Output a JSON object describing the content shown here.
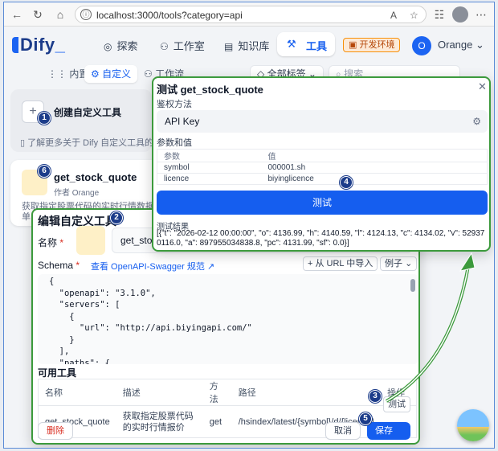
{
  "browser": {
    "url": "localhost:3000/tools?category=api",
    "info_icon": "ⓘ",
    "icons": [
      "back-icon",
      "refresh-icon",
      "home-icon",
      "read-aloud-icon",
      "favorite-icon",
      "collections-icon",
      "profile-icon",
      "more-icon"
    ]
  },
  "header": {
    "logo": "Dify",
    "nav": {
      "explore": "探索",
      "studio": "工作室",
      "knowledge": "知识库",
      "tools": "工具"
    },
    "env_badge": "开发环境",
    "user": {
      "initial": "O",
      "name": "Orange"
    }
  },
  "tabs": {
    "builtin": "内置",
    "custom": "自定义",
    "workflow": "工作流"
  },
  "filters": {
    "tags": "全部标签",
    "search_placeholder": "搜索"
  },
  "create_card": {
    "title": "创建自定义工具",
    "link": "了解更多关于 Dify 自定义工具的信"
  },
  "tool_card": {
    "name": "get_stock_quote",
    "author": "作者 Orange",
    "desc": "获取指定股票代码的实时行情数据，单日有限…跌"
  },
  "edit_dialog": {
    "title": "编辑自定义工具",
    "name_label": "名称",
    "name_value": "get_stock_quote",
    "schema_label": "Schema",
    "swagger_link": "查看 OpenAPI-Swagger 规范",
    "import_url": "+ 从 URL 中导入",
    "examples": "例子",
    "code": "{\n  \"openapi\": \"3.1.0\",\n  \"servers\": [\n    {\n      \"url\": \"http://api.biyingapi.com/\"\n    }\n  ],\n  \"paths\": {\n    \"/hsindex/latest/{",
    "tools_label": "可用工具",
    "columns": [
      "名称",
      "描述",
      "方法",
      "路径",
      "操作"
    ],
    "rows": [
      [
        "get_stock_quote",
        "获取指定股票代码的实时行情报价",
        "get",
        "/hsindex/latest/{symbol}/d/{licence}",
        "测试"
      ]
    ],
    "delete": "删除",
    "cancel": "取消",
    "save": "保存"
  },
  "test_dialog": {
    "title": "测试 get_stock_quote",
    "auth_label": "鉴权方法",
    "auth_value": "API Key",
    "params_label": "参数和值",
    "param_headers": [
      "参数",
      "值"
    ],
    "params": [
      [
        "symbol",
        "000001.sh"
      ],
      [
        "licence",
        "biyinglicence"
      ]
    ],
    "run_button": "测试",
    "result_label": "测试结果",
    "result": "[{\"t\": \"2026-02-12 00:00:00\", \"o\": 4136.99, \"h\": 4140.59, \"l\": 4124.13, \"c\": 4134.02, \"v\": 529370116.0, \"a\": 897955034838.8, \"pc\": 4131.99, \"sf\": 0.0}]"
  },
  "markers": [
    "1",
    "2",
    "3",
    "4",
    "5",
    "6"
  ],
  "colors": {
    "accent": "#155eef",
    "highlight_border": "#3c9a3c",
    "marker": "#1c3c8a"
  }
}
